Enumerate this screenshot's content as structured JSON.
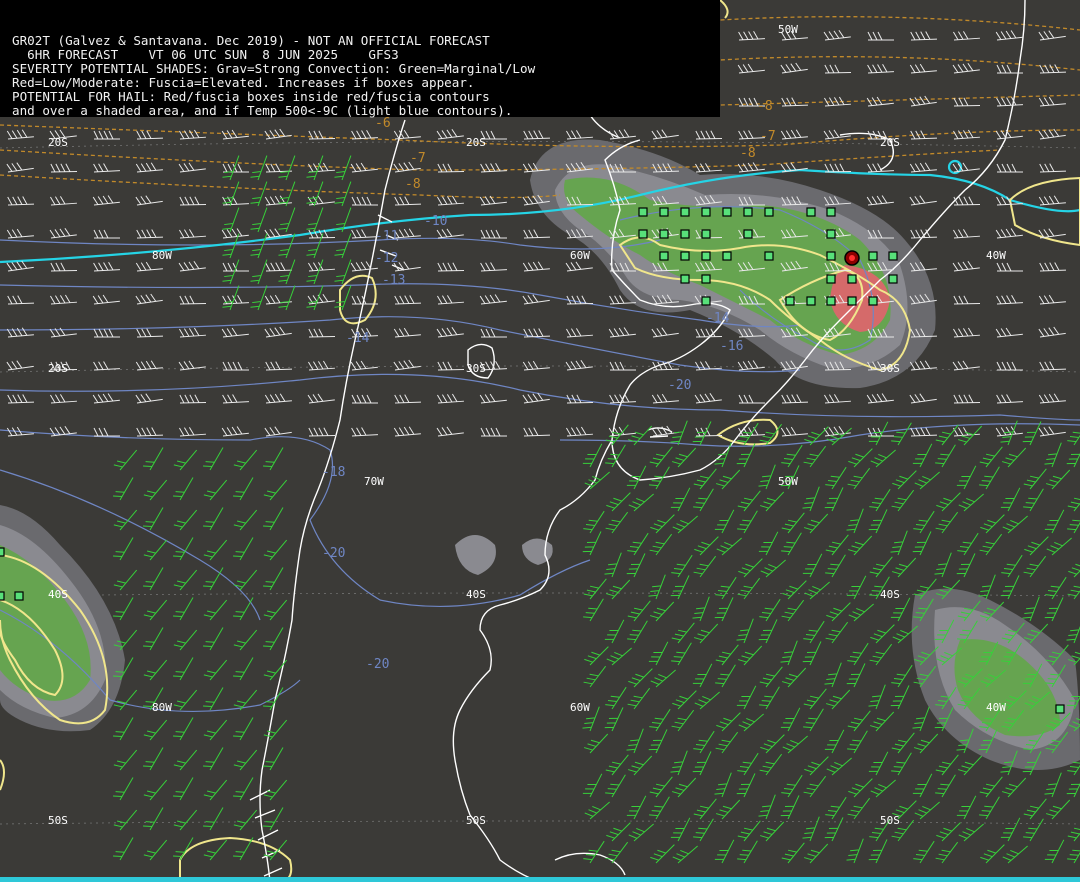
{
  "header": {
    "line1": "GR02T (Galvez & Santavana. Dec 2019) - NOT AN OFFICIAL FORECAST",
    "line2": "  6HR FORECAST    VT 06 UTC SUN  8 JUN 2025    GFS3",
    "line3": "SEVERITY POTENTIAL SHADES: Grav=Strong Convection: Green=Marginal/Low",
    "line4": "Red=Low/Moderate: Fuscia=Elevated. Increases if boxes appear.",
    "line5": "POTENTIAL FOR HAIL: Red/fuscia boxes inside red/fuscia contours",
    "line6": "and over a shaded area, and if Temp 500<-9C (light blue contours)."
  },
  "grid_labels": {
    "lat20_a": "20S",
    "lat20_b": "20S",
    "lat20_c": "20S",
    "lat20_d": "20S",
    "lat30_a": "20S",
    "lat30_b": "30S",
    "lat30_c": "30S",
    "lat40_a": "40S",
    "lat40_b": "40S",
    "lat40_c": "40S",
    "lat50_a": "50S",
    "lat50_b": "50S",
    "lat50_c": "50S",
    "lon80_a": "80W",
    "lon80_b": "80W",
    "lon70": "70W",
    "lon60_a": "60W",
    "lon60_b": "60W",
    "lon50_a": "50W",
    "lon50_b": "50W",
    "lon40_a": "40W",
    "lon40_b": "40W"
  },
  "temp_labels": {
    "t1": "-6",
    "t2": "-7",
    "t3": "-8",
    "t4": "-8",
    "t5": "-7",
    "t6": "-8",
    "t7": "-10",
    "t8": "-11",
    "t9": "-12",
    "t10": "-13",
    "t11": "-14",
    "t12": "-14",
    "t13": "-16",
    "t14": "-18",
    "t15": "-20",
    "t16": "-20",
    "t17": "-20"
  },
  "colors": {
    "background": "#3b3a37",
    "coastline": "#ffffff",
    "cold_contour": "#25d4e6",
    "cape_contour": "#f0e68c",
    "marginal": "#5fa845",
    "low_moderate": "#d56a6a",
    "boxes": "#58e07a"
  }
}
